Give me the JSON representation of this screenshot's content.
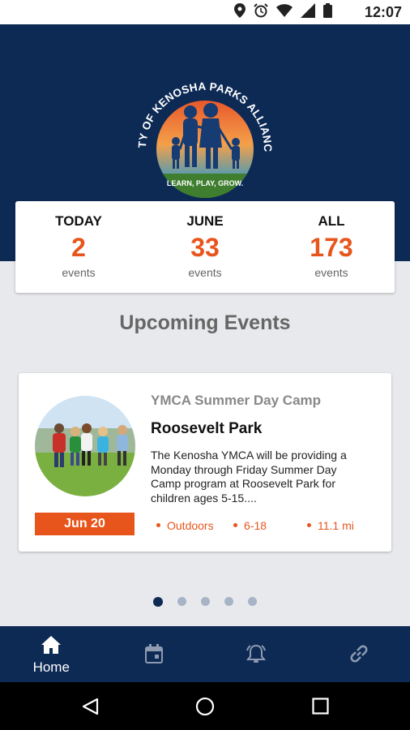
{
  "status_bar": {
    "time": "12:07"
  },
  "logo": {
    "arc_text": "CITY OF KENOSHA PARKS ALLIANCE",
    "tagline": "LEARN, PLAY, GROW."
  },
  "stats": [
    {
      "label": "TODAY",
      "value": "2",
      "unit": "events"
    },
    {
      "label": "JUNE",
      "value": "33",
      "unit": "events"
    },
    {
      "label": "ALL",
      "value": "173",
      "unit": "events"
    }
  ],
  "section_title": "Upcoming Events",
  "event": {
    "category": "YMCA Summer Day Camp",
    "title": "Roosevelt Park",
    "description": "The Kenosha YMCA will be providing a Monday through Friday Summer Day Camp program at Roosevelt Park for children ages 5-15....",
    "date": "Jun 20",
    "tags": [
      "Outdoors",
      "6-18",
      "11.1 mi"
    ]
  },
  "pager": {
    "count": 5,
    "active": 0
  },
  "bottom_nav": {
    "home_label": "Home",
    "items": [
      "home-icon",
      "calendar-icon",
      "alarm-icon",
      "link-icon"
    ]
  },
  "colors": {
    "navy": "#0d2a55",
    "accent": "#e8551c",
    "background": "#e8e9ec"
  }
}
